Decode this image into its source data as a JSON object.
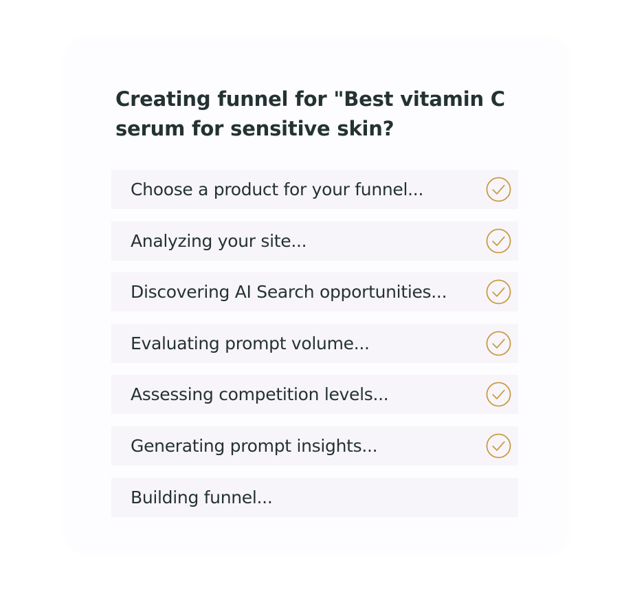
{
  "card": {
    "title": "Creating funnel for \"Best vitamin C serum for sensitive skin?"
  },
  "steps": [
    {
      "label": "Choose a product for your funnel...",
      "completed": true,
      "icon": "check-circle-icon"
    },
    {
      "label": "Analyzing your site...",
      "completed": true,
      "icon": "check-circle-icon"
    },
    {
      "label": "Discovering AI Search opportunities...",
      "completed": true,
      "icon": "check-circle-icon"
    },
    {
      "label": "Evaluating prompt volume...",
      "completed": true,
      "icon": "check-circle-icon"
    },
    {
      "label": "Assessing competition levels...",
      "completed": true,
      "icon": "check-circle-icon"
    },
    {
      "label": "Generating prompt insights...",
      "completed": true,
      "icon": "check-circle-icon"
    },
    {
      "label": "Building funnel...",
      "completed": false,
      "icon": ""
    }
  ],
  "colors": {
    "card_background": "#fdfcfe",
    "step_background": "#f7f5f9",
    "text": "#243232",
    "check_accent": "#c9993e"
  }
}
